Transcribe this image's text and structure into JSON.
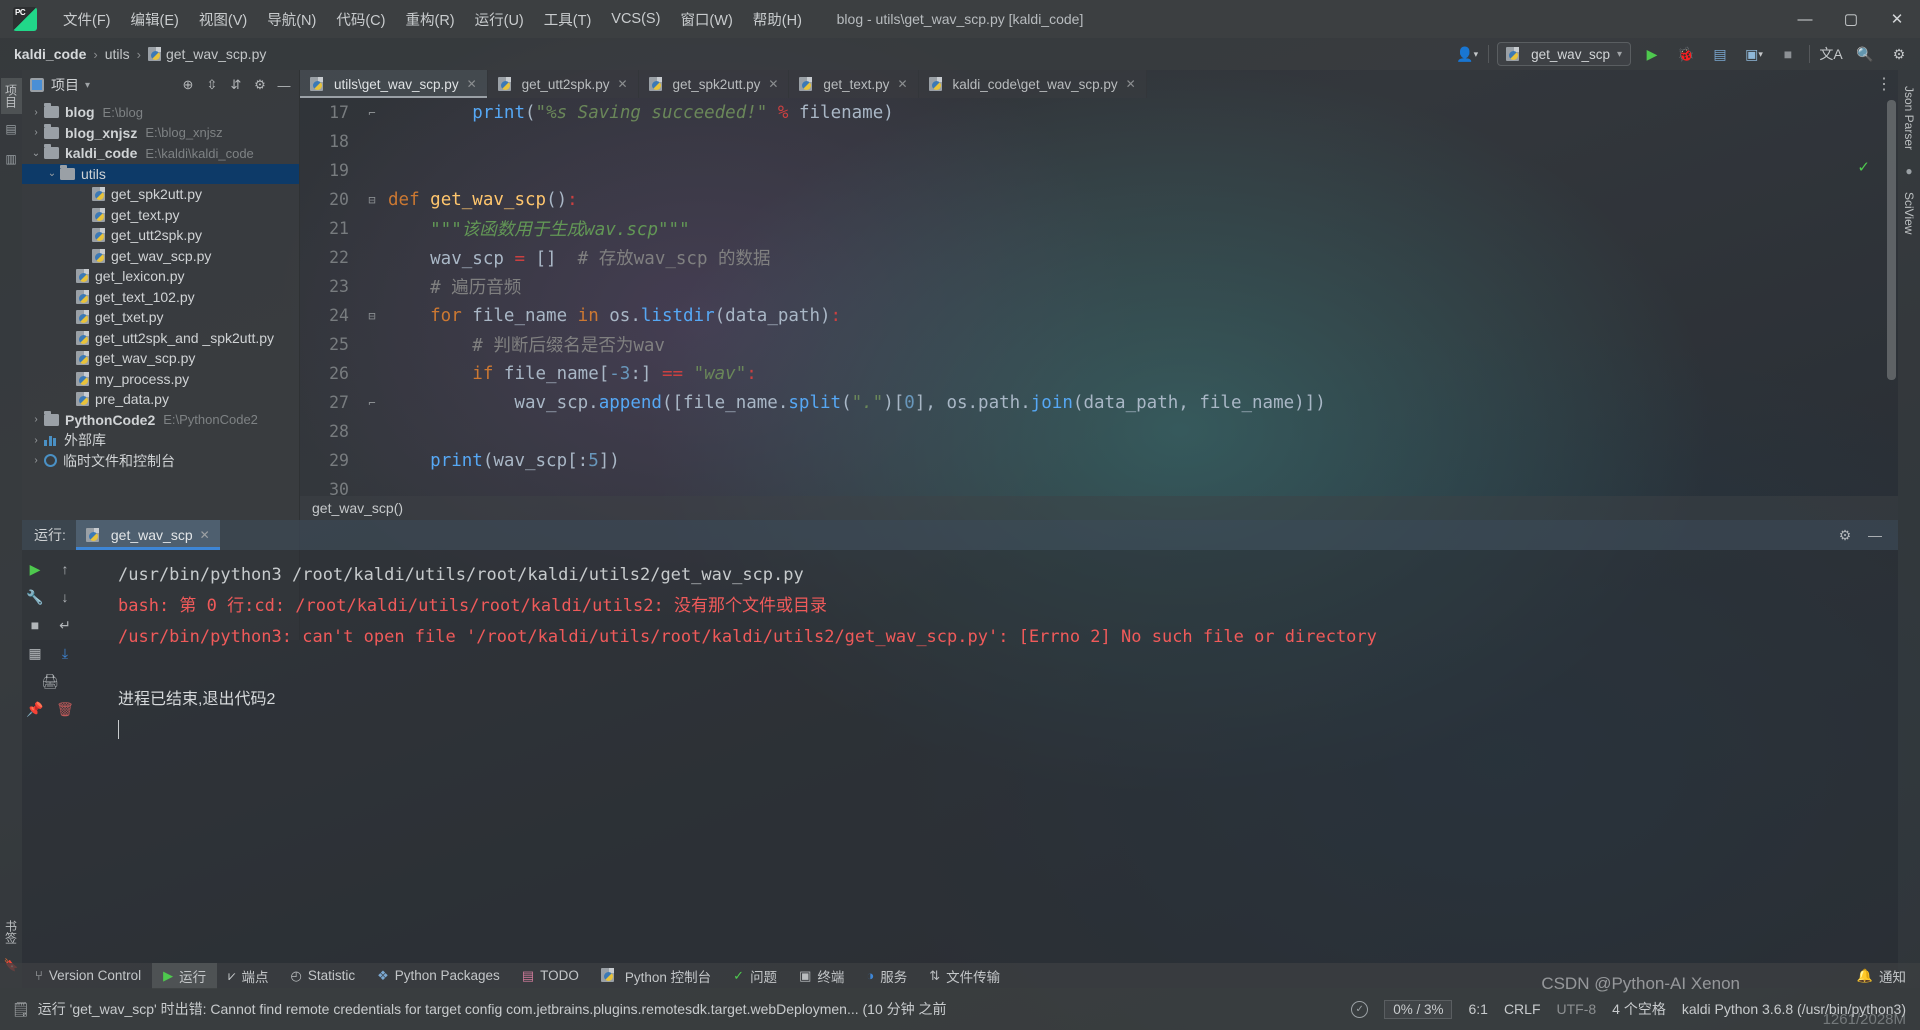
{
  "window": {
    "title": "blog - utils\\get_wav_scp.py [kaldi_code]",
    "minimize": "—",
    "maximize": "▢",
    "close": "✕"
  },
  "menu": {
    "items": [
      {
        "label": "文件(F)",
        "name": "menu-file"
      },
      {
        "label": "编辑(E)",
        "name": "menu-edit"
      },
      {
        "label": "视图(V)",
        "name": "menu-view"
      },
      {
        "label": "导航(N)",
        "name": "menu-navigate"
      },
      {
        "label": "代码(C)",
        "name": "menu-code"
      },
      {
        "label": "重构(R)",
        "name": "menu-refactor"
      },
      {
        "label": "运行(U)",
        "name": "menu-run"
      },
      {
        "label": "工具(T)",
        "name": "menu-tools"
      },
      {
        "label": "VCS(S)",
        "name": "menu-vcs"
      },
      {
        "label": "窗口(W)",
        "name": "menu-window"
      },
      {
        "label": "帮助(H)",
        "name": "menu-help"
      }
    ]
  },
  "breadcrumb": {
    "project": "kaldi_code",
    "folder": "utils",
    "file": "get_wav_scp.py",
    "separator": "›"
  },
  "navbar_right": {
    "run_config": "get_wav_scp",
    "chevron": "▾",
    "user_icon": "user-icon",
    "run": "▶",
    "debug": "🐞",
    "coverage": "▤",
    "profile": "▣",
    "stop": "■",
    "translate": "文A",
    "search": "🔍",
    "settings": "⚙"
  },
  "left_strip": {
    "tabs": [
      {
        "label": "项目",
        "name": "tool-tab-project",
        "selected": true
      },
      {
        "label": "数据库",
        "name": "tool-tab-database",
        "selected": false
      },
      {
        "label": "书签",
        "name": "tool-tab-bookmarks",
        "selected": false
      }
    ]
  },
  "right_strip": {
    "tabs": [
      {
        "label": "Json Parser",
        "name": "tool-tab-json-parser"
      },
      {
        "label": "SciView",
        "name": "tool-tab-sciview"
      }
    ]
  },
  "project_panel": {
    "title": "项目",
    "chevron": "▾",
    "icons": [
      "locate-icon",
      "collapse-all-icon",
      "expand-all-icon",
      "gear-icon",
      "hide-icon"
    ],
    "tree": [
      {
        "name": "blog",
        "path": "E:\\blog",
        "kind": "folder",
        "depth": 0,
        "arrow": "›",
        "bold": true,
        "selected": false
      },
      {
        "name": "blog_xnjsz",
        "path": "E:\\blog_xnjsz",
        "kind": "folder",
        "depth": 0,
        "arrow": "›",
        "bold": true,
        "selected": false
      },
      {
        "name": "kaldi_code",
        "path": "E:\\kaldi\\kaldi_code",
        "kind": "folder",
        "depth": 0,
        "arrow": "⌄",
        "bold": true,
        "selected": false
      },
      {
        "name": "utils",
        "path": "",
        "kind": "folder",
        "depth": 1,
        "arrow": "⌄",
        "bold": false,
        "selected": true
      },
      {
        "name": "get_spk2utt.py",
        "path": "",
        "kind": "python",
        "depth": 3,
        "arrow": "",
        "bold": false,
        "selected": false
      },
      {
        "name": "get_text.py",
        "path": "",
        "kind": "python",
        "depth": 3,
        "arrow": "",
        "bold": false,
        "selected": false
      },
      {
        "name": "get_utt2spk.py",
        "path": "",
        "kind": "python",
        "depth": 3,
        "arrow": "",
        "bold": false,
        "selected": false
      },
      {
        "name": "get_wav_scp.py",
        "path": "",
        "kind": "python",
        "depth": 3,
        "arrow": "",
        "bold": false,
        "selected": false
      },
      {
        "name": "get_lexicon.py",
        "path": "",
        "kind": "python",
        "depth": 2,
        "arrow": "",
        "bold": false,
        "selected": false
      },
      {
        "name": "get_text_102.py",
        "path": "",
        "kind": "python",
        "depth": 2,
        "arrow": "",
        "bold": false,
        "selected": false
      },
      {
        "name": "get_txet.py",
        "path": "",
        "kind": "python",
        "depth": 2,
        "arrow": "",
        "bold": false,
        "selected": false
      },
      {
        "name": "get_utt2spk_and _spk2utt.py",
        "path": "",
        "kind": "python",
        "depth": 2,
        "arrow": "",
        "bold": false,
        "selected": false
      },
      {
        "name": "get_wav_scp.py",
        "path": "",
        "kind": "python",
        "depth": 2,
        "arrow": "",
        "bold": false,
        "selected": false
      },
      {
        "name": "my_process.py",
        "path": "",
        "kind": "python",
        "depth": 2,
        "arrow": "",
        "bold": false,
        "selected": false
      },
      {
        "name": "pre_data.py",
        "path": "",
        "kind": "python",
        "depth": 2,
        "arrow": "",
        "bold": false,
        "selected": false
      },
      {
        "name": "PythonCode2",
        "path": "E:\\PythonCode2",
        "kind": "folder",
        "depth": 0,
        "arrow": "›",
        "bold": true,
        "selected": false
      },
      {
        "name": "外部库",
        "path": "",
        "kind": "library",
        "depth": 0,
        "arrow": "›",
        "bold": false,
        "selected": false
      },
      {
        "name": "临时文件和控制台",
        "path": "",
        "kind": "scratch",
        "depth": 0,
        "arrow": "›",
        "bold": false,
        "selected": false
      }
    ]
  },
  "editor": {
    "tabs": [
      {
        "label": "utils\\get_wav_scp.py",
        "active": true,
        "name": "editor-tab-utils-get-wav-scp"
      },
      {
        "label": "get_utt2spk.py",
        "active": false,
        "name": "editor-tab-get-utt2spk"
      },
      {
        "label": "get_spk2utt.py",
        "active": false,
        "name": "editor-tab-get-spk2utt"
      },
      {
        "label": "get_text.py",
        "active": false,
        "name": "editor-tab-get-text"
      },
      {
        "label": "kaldi_code\\get_wav_scp.py",
        "active": false,
        "name": "editor-tab-kaldi-code-get-wav-scp"
      }
    ],
    "close_glyph": "✕",
    "more_glyph": "⋮",
    "inspection_ok": "✓",
    "bottom_breadcrumb": "get_wav_scp()",
    "lines": [
      {
        "n": "17",
        "fold": "⌐",
        "tokens": [
          {
            "t": "        ",
            "c": "pl"
          },
          {
            "t": "print",
            "c": "mth"
          },
          {
            "t": "(",
            "c": "pl"
          },
          {
            "t": "\"%s Saving succeeded!\"",
            "c": "s"
          },
          {
            "t": " ",
            "c": "pl"
          },
          {
            "t": "%",
            "c": "red"
          },
          {
            "t": " filename)",
            "c": "pl"
          }
        ]
      },
      {
        "n": "18",
        "fold": "",
        "tokens": []
      },
      {
        "n": "19",
        "fold": "",
        "tokens": []
      },
      {
        "n": "20",
        "fold": "⊟",
        "tokens": [
          {
            "t": "def ",
            "c": "k"
          },
          {
            "t": "get_wav_scp",
            "c": "fn"
          },
          {
            "t": "()",
            "c": "pl"
          },
          {
            "t": ":",
            "c": "red"
          }
        ]
      },
      {
        "n": "21",
        "fold": "",
        "tokens": [
          {
            "t": "    \"\"\"该函数用于生成wav.scp\"\"\"",
            "c": "doc"
          }
        ]
      },
      {
        "n": "22",
        "fold": "",
        "tokens": [
          {
            "t": "    wav_scp ",
            "c": "pl"
          },
          {
            "t": "=",
            "c": "red"
          },
          {
            "t": " []  ",
            "c": "pl"
          },
          {
            "t": "# 存放wav_scp 的数据",
            "c": "cm"
          }
        ]
      },
      {
        "n": "23",
        "fold": "",
        "tokens": [
          {
            "t": "    # 遍历音频",
            "c": "cm"
          }
        ]
      },
      {
        "n": "24",
        "fold": "⊟",
        "tokens": [
          {
            "t": "    for ",
            "c": "k"
          },
          {
            "t": "file_name ",
            "c": "pl"
          },
          {
            "t": "in ",
            "c": "k"
          },
          {
            "t": "os.",
            "c": "pl"
          },
          {
            "t": "listdir",
            "c": "mth"
          },
          {
            "t": "(data_path)",
            "c": "pl"
          },
          {
            "t": ":",
            "c": "red"
          }
        ]
      },
      {
        "n": "25",
        "fold": "",
        "tokens": [
          {
            "t": "        # 判断后缀名是否为wav",
            "c": "cm"
          }
        ]
      },
      {
        "n": "26",
        "fold": "",
        "tokens": [
          {
            "t": "        if ",
            "c": "k"
          },
          {
            "t": "file_name[",
            "c": "pl"
          },
          {
            "t": "-3",
            "c": "num"
          },
          {
            "t": ":] ",
            "c": "pl"
          },
          {
            "t": "==",
            "c": "red"
          },
          {
            "t": " ",
            "c": "pl"
          },
          {
            "t": "\"wav\"",
            "c": "s"
          },
          {
            "t": ":",
            "c": "red"
          }
        ]
      },
      {
        "n": "27",
        "fold": "⌐",
        "tokens": [
          {
            "t": "            wav_scp.",
            "c": "pl"
          },
          {
            "t": "append",
            "c": "mth"
          },
          {
            "t": "([file_name.",
            "c": "pl"
          },
          {
            "t": "split",
            "c": "mth"
          },
          {
            "t": "(",
            "c": "pl"
          },
          {
            "t": "\".\"",
            "c": "s"
          },
          {
            "t": ")[",
            "c": "pl"
          },
          {
            "t": "0",
            "c": "num"
          },
          {
            "t": "], os.path.",
            "c": "pl"
          },
          {
            "t": "join",
            "c": "mth"
          },
          {
            "t": "(data_path, file_name)])",
            "c": "pl"
          }
        ]
      },
      {
        "n": "28",
        "fold": "",
        "tokens": []
      },
      {
        "n": "29",
        "fold": "",
        "tokens": [
          {
            "t": "    ",
            "c": "pl"
          },
          {
            "t": "print",
            "c": "mth"
          },
          {
            "t": "(wav_scp[:",
            "c": "pl"
          },
          {
            "t": "5",
            "c": "num"
          },
          {
            "t": "])",
            "c": "pl"
          }
        ]
      },
      {
        "n": "30",
        "fold": "",
        "tokens": []
      }
    ]
  },
  "run_panel": {
    "label": "运行:",
    "tab": "get_wav_scp",
    "close_glyph": "✕",
    "settings_glyph": "⚙",
    "minimize_glyph": "—",
    "side_icons": [
      "rerun-icon",
      "up-arrow-icon",
      "wrench-icon",
      "down-arrow-icon",
      "stop-icon",
      "scroll-to-end-icon",
      "layout-icon",
      "print-icon",
      "pin-icon",
      "trash-icon"
    ],
    "console_lines": [
      {
        "text": "/usr/bin/python3 /root/kaldi/utils/root/kaldi/utils2/get_wav_scp.py",
        "style": "norm"
      },
      {
        "text": "bash: 第 0 行:cd: /root/kaldi/utils/root/kaldi/utils2: 没有那个文件或目录",
        "style": "err"
      },
      {
        "text": "/usr/bin/python3: can't open file '/root/kaldi/utils/root/kaldi/utils2/get_wav_scp.py': [Errno 2] No such file or directory",
        "style": "err"
      },
      {
        "text": "",
        "style": "norm"
      },
      {
        "text": "进程已结束,退出代码2",
        "style": "cn"
      }
    ]
  },
  "bottom_toolbar": {
    "items": [
      {
        "label": "Version Control",
        "icon": "branch-icon",
        "name": "tool-version-control",
        "selected": false
      },
      {
        "label": "运行",
        "icon": "run-icon",
        "name": "tool-run",
        "selected": true
      },
      {
        "label": "端点",
        "icon": "breakpoint-icon",
        "name": "tool-endpoints",
        "selected": false
      },
      {
        "label": "Statistic",
        "icon": "clock-icon",
        "name": "tool-statistic",
        "selected": false
      },
      {
        "label": "Python Packages",
        "icon": "packages-icon",
        "name": "tool-python-packages",
        "selected": false
      },
      {
        "label": "TODO",
        "icon": "todo-icon",
        "name": "tool-todo",
        "selected": false
      },
      {
        "label": "Python 控制台",
        "icon": "python-icon",
        "name": "tool-python-console",
        "selected": false
      },
      {
        "label": "问题",
        "icon": "check-icon",
        "name": "tool-problems",
        "selected": false
      },
      {
        "label": "终端",
        "icon": "terminal-icon",
        "name": "tool-terminal",
        "selected": false
      },
      {
        "label": "服务",
        "icon": "services-icon",
        "name": "tool-services",
        "selected": false
      },
      {
        "label": "文件传输",
        "icon": "transfer-icon",
        "name": "tool-file-transfer",
        "selected": false
      }
    ],
    "notifications": "通知",
    "notifications_icon": "bell-icon"
  },
  "status_bar": {
    "message": "运行 'get_wav_scp' 时出错: Cannot find remote credentials for target config com.jetbrains.plugins.remotesdk.target.webDeploymen... (10 分钟 之前",
    "message_icon": "event-log-icon",
    "memory": "0% / 3%",
    "caret_position": "6:1",
    "line_separator": "CRLF",
    "encoding": "UTF-8",
    "indent": "4 个空格",
    "interpreter": "kaldi Python 3.6.8 (/usr/bin/python3)",
    "inspection_icon": "inspection-ok-icon"
  },
  "watermark": {
    "text": "CSDN @Python-AI Xenon",
    "corner": "1261/2028M"
  }
}
